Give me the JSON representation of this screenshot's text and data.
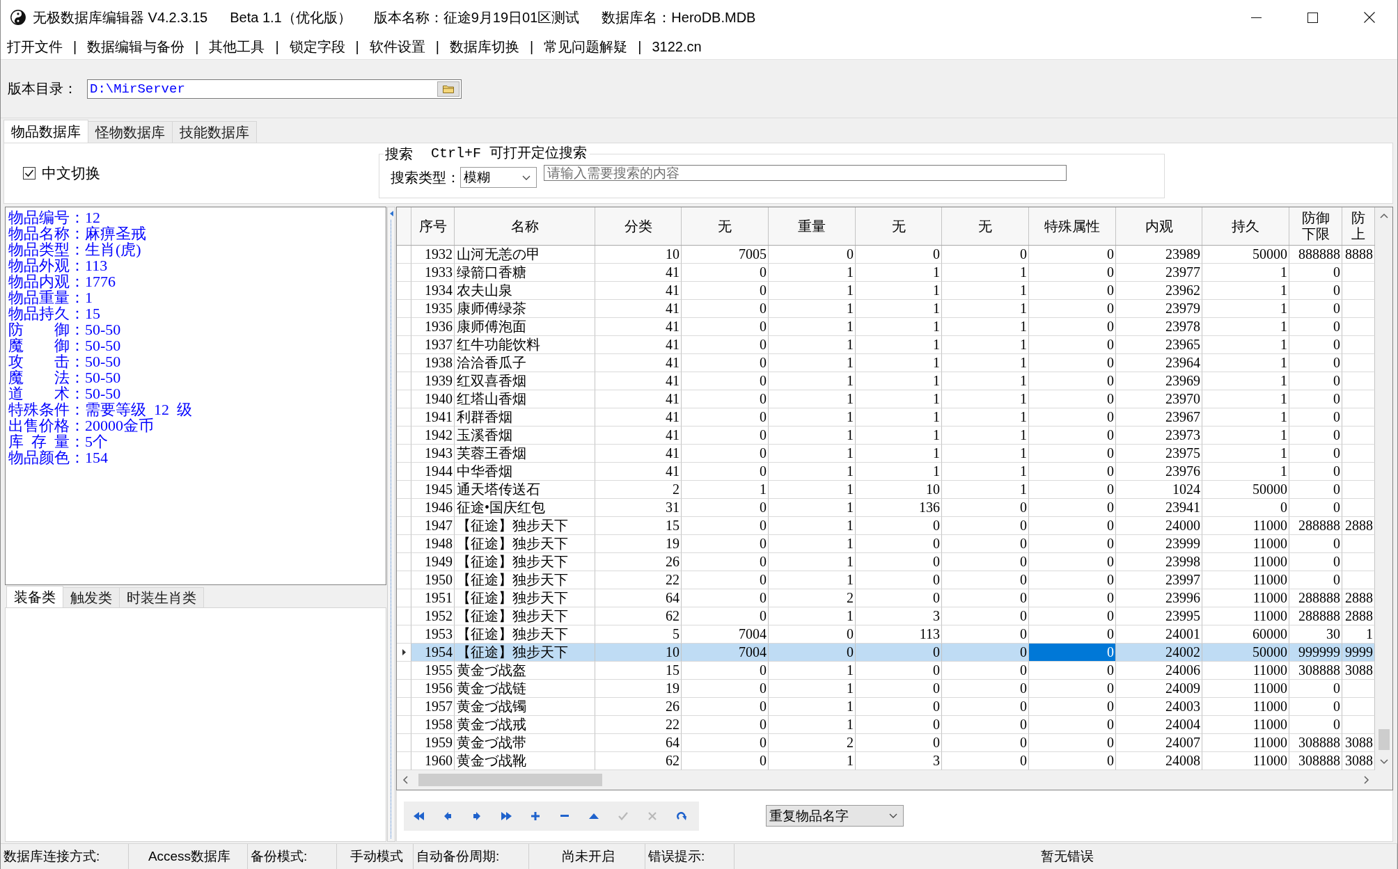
{
  "window": {
    "title_parts": [
      "无极数据库编辑器 V4.2.3.15",
      "Beta 1.1（优化版）",
      "版本名称：征途9月19日01区测试",
      "数据库名：HeroDB.MDB"
    ]
  },
  "menu": [
    {
      "kind": "item",
      "label": "打开文件"
    },
    {
      "kind": "separator",
      "label": "|"
    },
    {
      "kind": "item",
      "label": "数据编辑与备份"
    },
    {
      "kind": "separator",
      "label": "|"
    },
    {
      "kind": "item",
      "label": "其他工具"
    },
    {
      "kind": "separator",
      "label": "|"
    },
    {
      "kind": "item",
      "label": "锁定字段"
    },
    {
      "kind": "separator",
      "label": "|"
    },
    {
      "kind": "item",
      "label": "软件设置"
    },
    {
      "kind": "separator",
      "label": "|"
    },
    {
      "kind": "item",
      "label": "数据库切换"
    },
    {
      "kind": "separator",
      "label": "|"
    },
    {
      "kind": "item",
      "label": "常见问题解疑"
    },
    {
      "kind": "separator",
      "label": "|"
    },
    {
      "kind": "item",
      "label": "3122.cn"
    }
  ],
  "version_path": {
    "label": "版本目录：",
    "value": "D:\\MirServer"
  },
  "tabs": [
    {
      "label": "物品数据库",
      "selected": true
    },
    {
      "label": "怪物数据库",
      "selected": false
    },
    {
      "label": "技能数据库",
      "selected": false
    }
  ],
  "search_panel": {
    "chinese_toggle": {
      "label": "中文切换",
      "checked": true
    },
    "group_title": "搜索",
    "hint": "Ctrl+F 可打开定位搜索",
    "type_label": "搜索类型：",
    "type_value": "模糊",
    "placeholder": "请输入需要搜索的内容"
  },
  "item_info": {
    "lines": [
      "物品编号：12",
      "物品名称：麻痹圣戒",
      "物品类型：生肖(虎)",
      "物品外观：113",
      "物品内观：1776",
      "物品重量：1",
      "物品持久：15",
      "防    御：50-50",
      "魔    御：50-50",
      "攻    击：50-50",
      "魔    法：50-50",
      "道    术：50-50",
      "特殊条件：需要等级 12 级",
      "出售价格：20000金币",
      "库 存 量：5个",
      "物品颜色：154"
    ]
  },
  "category_tabs": [
    {
      "label": "装备类",
      "selected": true
    },
    {
      "label": "触发类",
      "selected": false
    },
    {
      "label": "时装生肖类",
      "selected": false
    }
  ],
  "table": {
    "columns": [
      {
        "heading": "序号",
        "kind": "number",
        "focused": false
      },
      {
        "heading": "名称",
        "kind": "text",
        "focused": false
      },
      {
        "heading": "分类",
        "kind": "number",
        "focused": false
      },
      {
        "heading": "无",
        "kind": "number",
        "focused": false
      },
      {
        "heading": "重量",
        "kind": "number",
        "focused": false
      },
      {
        "heading": "无",
        "kind": "number",
        "focused": false
      },
      {
        "heading": "无",
        "kind": "number",
        "focused": false
      },
      {
        "heading": "特殊属性",
        "kind": "number",
        "focused": true
      },
      {
        "heading": "内观",
        "kind": "number",
        "focused": false
      },
      {
        "heading": "持久",
        "kind": "number",
        "focused": false
      },
      {
        "heading": "防御下限",
        "kind": "number",
        "focused": false
      },
      {
        "heading": "防上",
        "kind": "number",
        "focused": false
      }
    ],
    "rows": [
      {
        "selected": false,
        "cells": [
          "1932",
          "山河无恙の甲",
          "10",
          "7005",
          "0",
          "0",
          "0",
          "0",
          "23989",
          "50000",
          "888888",
          "8888"
        ]
      },
      {
        "selected": false,
        "cells": [
          "1933",
          "绿箭口香糖",
          "41",
          "0",
          "1",
          "1",
          "1",
          "0",
          "23977",
          "1",
          "0"
        ]
      },
      {
        "selected": false,
        "cells": [
          "1934",
          "农夫山泉",
          "41",
          "0",
          "1",
          "1",
          "1",
          "0",
          "23962",
          "1",
          "0"
        ]
      },
      {
        "selected": false,
        "cells": [
          "1935",
          "康师傅绿茶",
          "41",
          "0",
          "1",
          "1",
          "1",
          "0",
          "23979",
          "1",
          "0"
        ]
      },
      {
        "selected": false,
        "cells": [
          "1936",
          "康师傅泡面",
          "41",
          "0",
          "1",
          "1",
          "1",
          "0",
          "23978",
          "1",
          "0"
        ]
      },
      {
        "selected": false,
        "cells": [
          "1937",
          "红牛功能饮料",
          "41",
          "0",
          "1",
          "1",
          "1",
          "0",
          "23965",
          "1",
          "0"
        ]
      },
      {
        "selected": false,
        "cells": [
          "1938",
          "洽洽香瓜子",
          "41",
          "0",
          "1",
          "1",
          "1",
          "0",
          "23964",
          "1",
          "0"
        ]
      },
      {
        "selected": false,
        "cells": [
          "1939",
          "红双喜香烟",
          "41",
          "0",
          "1",
          "1",
          "1",
          "0",
          "23969",
          "1",
          "0"
        ]
      },
      {
        "selected": false,
        "cells": [
          "1940",
          "红塔山香烟",
          "41",
          "0",
          "1",
          "1",
          "1",
          "0",
          "23970",
          "1",
          "0"
        ]
      },
      {
        "selected": false,
        "cells": [
          "1941",
          "利群香烟",
          "41",
          "0",
          "1",
          "1",
          "1",
          "0",
          "23967",
          "1",
          "0"
        ]
      },
      {
        "selected": false,
        "cells": [
          "1942",
          "玉溪香烟",
          "41",
          "0",
          "1",
          "1",
          "1",
          "0",
          "23973",
          "1",
          "0"
        ]
      },
      {
        "selected": false,
        "cells": [
          "1943",
          "芙蓉王香烟",
          "41",
          "0",
          "1",
          "1",
          "1",
          "0",
          "23975",
          "1",
          "0"
        ]
      },
      {
        "selected": false,
        "cells": [
          "1944",
          "中华香烟",
          "41",
          "0",
          "1",
          "1",
          "1",
          "0",
          "23976",
          "1",
          "0"
        ]
      },
      {
        "selected": false,
        "cells": [
          "1945",
          "通天塔传送石",
          "2",
          "1",
          "1",
          "10",
          "1",
          "0",
          "1024",
          "50000",
          "0"
        ]
      },
      {
        "selected": false,
        "cells": [
          "1946",
          "征途•国庆红包",
          "31",
          "0",
          "1",
          "136",
          "0",
          "0",
          "23941",
          "0",
          "0"
        ]
      },
      {
        "selected": false,
        "cells": [
          "1947",
          "【征途】独步天下",
          "15",
          "0",
          "1",
          "0",
          "0",
          "0",
          "24000",
          "11000",
          "288888",
          "2888"
        ]
      },
      {
        "selected": false,
        "cells": [
          "1948",
          "【征途】独步天下",
          "19",
          "0",
          "1",
          "0",
          "0",
          "0",
          "23999",
          "11000",
          "0"
        ]
      },
      {
        "selected": false,
        "cells": [
          "1949",
          "【征途】独步天下",
          "26",
          "0",
          "1",
          "0",
          "0",
          "0",
          "23998",
          "11000",
          "0"
        ]
      },
      {
        "selected": false,
        "cells": [
          "1950",
          "【征途】独步天下",
          "22",
          "0",
          "1",
          "0",
          "0",
          "0",
          "23997",
          "11000",
          "0"
        ]
      },
      {
        "selected": false,
        "cells": [
          "1951",
          "【征途】独步天下",
          "64",
          "0",
          "2",
          "0",
          "0",
          "0",
          "23996",
          "11000",
          "288888",
          "2888"
        ]
      },
      {
        "selected": false,
        "cells": [
          "1952",
          "【征途】独步天下",
          "62",
          "0",
          "1",
          "3",
          "0",
          "0",
          "23995",
          "11000",
          "288888",
          "2888"
        ]
      },
      {
        "selected": false,
        "cells": [
          "1953",
          "【征途】独步天下",
          "5",
          "7004",
          "0",
          "113",
          "0",
          "0",
          "24001",
          "60000",
          "30",
          "1"
        ]
      },
      {
        "selected": true,
        "cells": [
          "1954",
          "【征途】独步天下",
          "10",
          "7004",
          "0",
          "0",
          "0",
          "0",
          "24002",
          "50000",
          "999999",
          "9999"
        ]
      },
      {
        "selected": false,
        "cells": [
          "1955",
          "黄金づ战盔",
          "15",
          "0",
          "1",
          "0",
          "0",
          "0",
          "24006",
          "11000",
          "308888",
          "3088"
        ]
      },
      {
        "selected": false,
        "cells": [
          "1956",
          "黄金づ战链",
          "19",
          "0",
          "1",
          "0",
          "0",
          "0",
          "24009",
          "11000",
          "0"
        ]
      },
      {
        "selected": false,
        "cells": [
          "1957",
          "黄金づ战镯",
          "26",
          "0",
          "1",
          "0",
          "0",
          "0",
          "24003",
          "11000",
          "0"
        ]
      },
      {
        "selected": false,
        "cells": [
          "1958",
          "黄金づ战戒",
          "22",
          "0",
          "1",
          "0",
          "0",
          "0",
          "24004",
          "11000",
          "0"
        ]
      },
      {
        "selected": false,
        "cells": [
          "1959",
          "黄金づ战带",
          "64",
          "0",
          "2",
          "0",
          "0",
          "0",
          "24007",
          "11000",
          "308888",
          "3088"
        ]
      },
      {
        "selected": false,
        "cells": [
          "1960",
          "黄金づ战靴",
          "62",
          "0",
          "1",
          "3",
          "0",
          "0",
          "24008",
          "11000",
          "308888",
          "3088"
        ]
      }
    ]
  },
  "navigator": {
    "buttons": [
      {
        "kind": "first",
        "disabled": false
      },
      {
        "kind": "prior",
        "disabled": false
      },
      {
        "kind": "next",
        "disabled": false
      },
      {
        "kind": "last",
        "disabled": false
      },
      {
        "kind": "insert",
        "disabled": false
      },
      {
        "kind": "delete",
        "disabled": false
      },
      {
        "kind": "edit",
        "disabled": false
      },
      {
        "kind": "post",
        "disabled": true
      },
      {
        "kind": "cancel",
        "disabled": true
      },
      {
        "kind": "refresh",
        "disabled": false
      }
    ]
  },
  "duplicate_filter": {
    "value": "重复物品名字"
  },
  "status_bar": [
    {
      "label": "数据库连接方式:",
      "value": "Access数据库"
    },
    {
      "label": "备份模式:",
      "value": "手动模式"
    },
    {
      "label": "自动备份周期:",
      "value": "尚未开启"
    },
    {
      "label": "错误提示:",
      "value": "暂无错误"
    }
  ]
}
